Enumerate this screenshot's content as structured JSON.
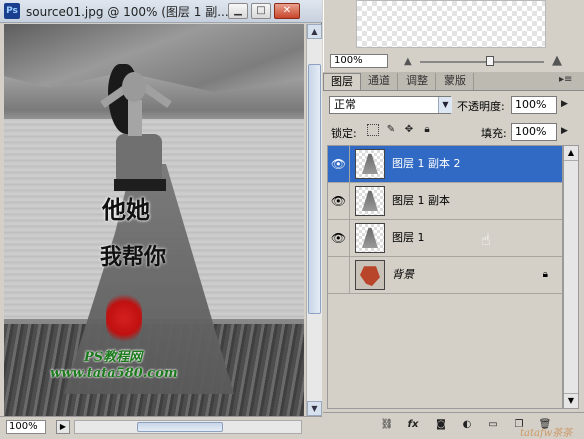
{
  "document": {
    "title": "source01.jpg @ 100% (图层 1 副...",
    "zoom": "100%",
    "calligraphy_line1": "他她",
    "calligraphy_line2": "我帮你",
    "watermark_line1": "PS教程网",
    "watermark_line2": "www.tata580.com"
  },
  "navigator": {
    "zoom": "100%"
  },
  "layers_panel": {
    "tabs": [
      "图层",
      "通道",
      "调整",
      "蒙版"
    ],
    "blend_mode": "正常",
    "opacity_label": "不透明度:",
    "opacity_value": "100%",
    "lock_label": "锁定:",
    "fill_label": "填充:",
    "fill_value": "100%",
    "layers": [
      {
        "name": "图层 1 副本 2",
        "visible": true,
        "selected": true
      },
      {
        "name": "图层 1 副本",
        "visible": true,
        "selected": false
      },
      {
        "name": "图层 1",
        "visible": true,
        "selected": false
      },
      {
        "name": "背景",
        "visible": false,
        "selected": false,
        "locked": true
      }
    ],
    "colors": {
      "selection": "#316ac5",
      "panel_bg": "#d4d0c8"
    }
  },
  "corner_watermark": "tatafw茶茶"
}
